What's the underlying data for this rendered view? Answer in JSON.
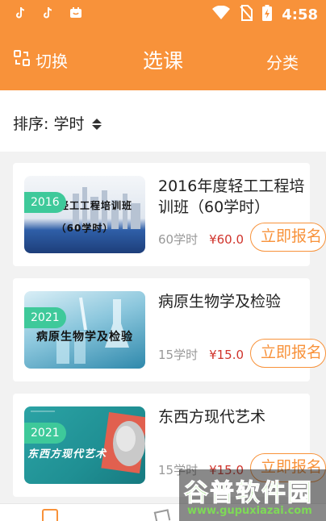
{
  "status_bar": {
    "left_icons": [
      "tiktok-icon",
      "tiktok-icon",
      "app-icon"
    ],
    "right_icons": [
      "wifi-icon",
      "no-sim-icon",
      "battery-charging-icon"
    ],
    "time": "4:58"
  },
  "header": {
    "switch_label": "切换",
    "title": "选课",
    "category_label": "分类",
    "color": "#f8923a"
  },
  "sort": {
    "label": "排序: 学时"
  },
  "courses": [
    {
      "year": "2016",
      "thumb_text": "度轻工工程培训班",
      "thumb_text2": "（60学时）",
      "title": "2016年度轻工工程培训班（60学时）",
      "hours": "60学时",
      "price": "¥60.0",
      "button": "立即报名"
    },
    {
      "year": "2021",
      "thumb_text": "病原生物学及检验",
      "title": "病原生物学及检验",
      "hours": "15学时",
      "price": "¥15.0",
      "button": "立即报名"
    },
    {
      "year": "2021",
      "thumb_text": "东西方现代艺术",
      "title": "东西方现代艺术",
      "hours": "15学时",
      "price": "¥15.0",
      "button": "立即报名"
    }
  ],
  "watermark": {
    "brand": "谷普软件园",
    "url": "www.gupuxiazai.com"
  }
}
